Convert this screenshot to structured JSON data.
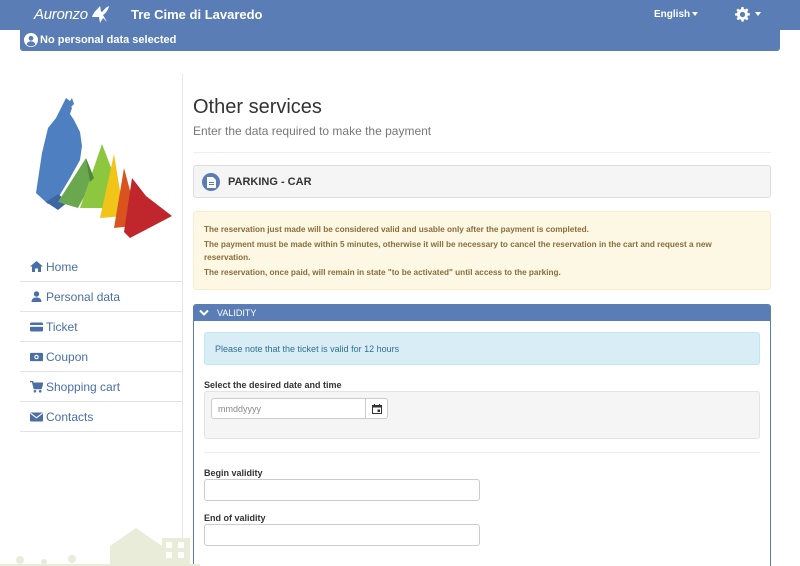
{
  "header": {
    "logo_text": "Auronzo",
    "site_title": "Tre Cime di Lavaredo",
    "language": "English"
  },
  "userbar": {
    "text": "No personal data selected"
  },
  "sidebar": {
    "items": [
      {
        "label": "Home",
        "icon": "home-icon"
      },
      {
        "label": "Personal data",
        "icon": "user-icon"
      },
      {
        "label": "Ticket",
        "icon": "ticket-icon"
      },
      {
        "label": "Coupon",
        "icon": "coupon-icon"
      },
      {
        "label": "Shopping cart",
        "icon": "cart-icon"
      },
      {
        "label": "Contacts",
        "icon": "envelope-icon"
      }
    ]
  },
  "main": {
    "title": "Other services",
    "subtitle": "Enter the data required to make the payment",
    "service_label": "PARKING - CAR",
    "warnings": [
      "The reservation just made will be considered valid and usable only after the payment is completed.",
      "The payment must be made within 5 minutes, otherwise it will be necessary to cancel the reservation in the cart and request a new reservation.",
      "The reservation, once paid, will remain in state \"to be activated\" until access to the parking."
    ],
    "validity": {
      "heading": "VALIDITY",
      "info": "Please note that the ticket is valid for 12 hours",
      "date_label": "Select the desired date and time",
      "date_placeholder": "mmddyyyy",
      "begin_label": "Begin validity",
      "begin_value": "",
      "end_label": "End of validity",
      "end_value": ""
    }
  },
  "colors": {
    "brand": "#5a7db5",
    "warning_bg": "#fcf8e3",
    "warning_text": "#8a6d3b",
    "info_bg": "#d9edf7",
    "info_text": "#31708f"
  }
}
